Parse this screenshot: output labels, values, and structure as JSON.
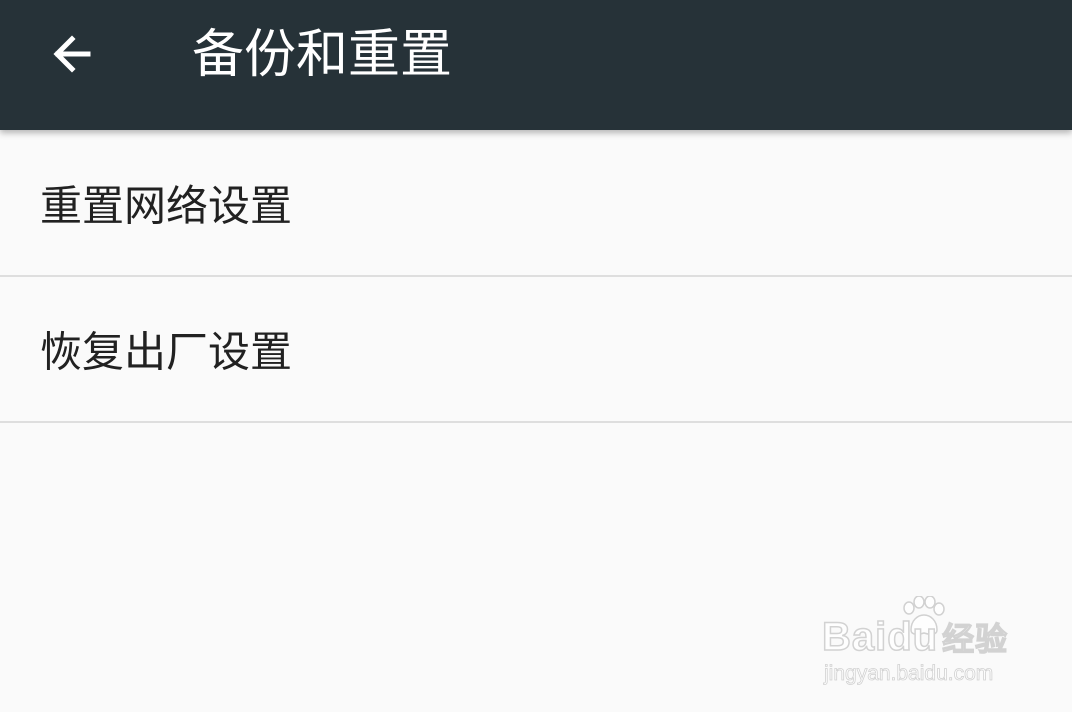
{
  "app_bar": {
    "title": "备份和重置",
    "back_icon": "arrow-back-icon",
    "background_color": "#263238",
    "title_color": "#ffffff"
  },
  "settings": {
    "items": [
      {
        "label": "重置网络设置"
      },
      {
        "label": "恢复出厂设置"
      }
    ]
  },
  "watermark": {
    "brand_latin": "Baidu",
    "brand_cn": "经验",
    "url": "jingyan.baidu.com"
  }
}
